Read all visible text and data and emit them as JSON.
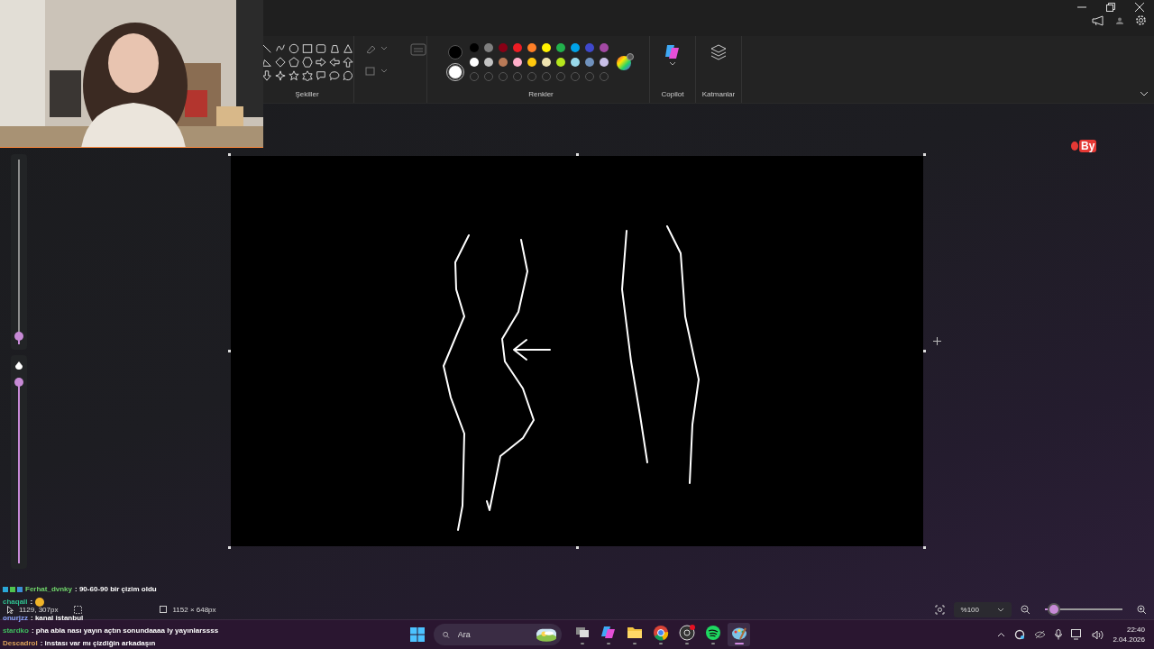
{
  "ribbon": {
    "groups": [
      {
        "label": "Şekiller"
      },
      {
        "label": "Renkler"
      },
      {
        "label": "Copilot"
      },
      {
        "label": "Katmanlar"
      }
    ],
    "current_colors": [
      {
        "color": "#000000"
      },
      {
        "color": "#ffffff"
      }
    ],
    "palette": [
      {
        "color": "#000000"
      },
      {
        "color": "#7f7f7f"
      },
      {
        "color": "#880015"
      },
      {
        "color": "#ed1c24"
      },
      {
        "color": "#ff7f27"
      },
      {
        "color": "#fff200"
      },
      {
        "color": "#22b14c"
      },
      {
        "color": "#00a2e8"
      },
      {
        "color": "#3f48cc"
      },
      {
        "color": "#a349a4"
      },
      {
        "color": "#ffffff"
      },
      {
        "color": "#c3c3c3"
      },
      {
        "color": "#b97a57"
      },
      {
        "color": "#ffaec9"
      },
      {
        "color": "#ffc90e"
      },
      {
        "color": "#efe4b0"
      },
      {
        "color": "#b5e61d"
      },
      {
        "color": "#99d9ea"
      },
      {
        "color": "#7092be"
      },
      {
        "color": "#c8bfe7"
      }
    ],
    "custom_slots": [
      {
        "filled": false
      },
      {
        "filled": false
      },
      {
        "filled": false
      },
      {
        "filled": false
      },
      {
        "filled": false
      },
      {
        "filled": false
      },
      {
        "filled": false
      },
      {
        "filled": false
      },
      {
        "filled": false
      },
      {
        "filled": false
      }
    ]
  },
  "side_sliders": [
    {
      "kind": "size",
      "level": 0.02
    },
    {
      "kind": "opacity",
      "level": 1
    }
  ],
  "overlay_badge": "By",
  "status_bar": {
    "cursor_position": "1129, 307px",
    "canvas_size": "1152 × 648px",
    "zoom": "%100",
    "zoom_slider": {
      "level": 0.12
    }
  },
  "chat": [
    {
      "user": "Ferhat_dvnky",
      "color": "#6fd36a",
      "text": ": 90-60-90 bir çizim oldu",
      "kind": "badged"
    },
    {
      "user": "chaqall",
      "color": "#2fbf8f",
      "text": ":",
      "kind": "emoji"
    },
    {
      "user": "onurjzz",
      "color": "#8fa6ff",
      "text": ": kanal istanbul",
      "kind": "plain"
    },
    {
      "user": "stardko",
      "color": "#3fbf5f",
      "text": ": pha abla nası yayın açtın sonundaaaa ly yayınlarssss",
      "kind": "plain"
    },
    {
      "user": "Descadrol",
      "color": "#d9a05a",
      "text": ": instası var mı çizdiğin arkadaşın",
      "kind": "plain"
    }
  ],
  "taskbar": {
    "search_placeholder": "Ara",
    "apps": [
      {
        "kind": "taskview",
        "selected": false
      },
      {
        "kind": "copilot",
        "selected": false
      },
      {
        "kind": "folder",
        "selected": false
      },
      {
        "kind": "browser",
        "selected": false
      },
      {
        "kind": "recorder",
        "selected": false
      },
      {
        "kind": "music",
        "selected": false
      },
      {
        "kind": "paint",
        "selected": true
      }
    ],
    "time": "22:40",
    "date": "2.04.2026"
  }
}
